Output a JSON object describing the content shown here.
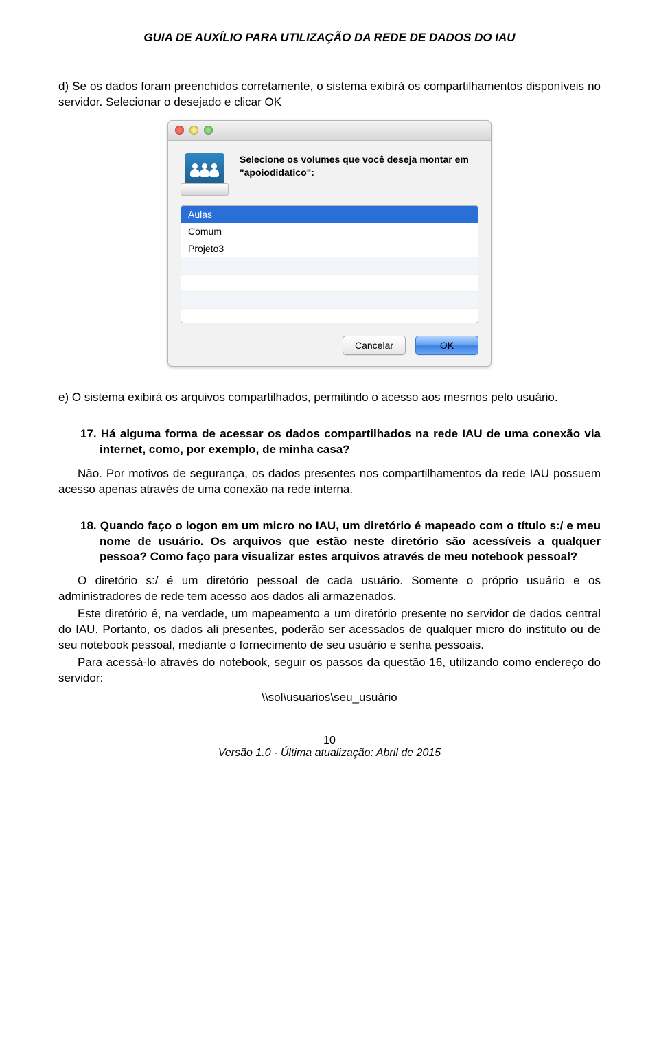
{
  "header": {
    "title": "GUIA DE AUXÍLIO PARA UTILIZAÇÃO DA REDE DE DADOS DO IAU"
  },
  "body": {
    "p_d": "d) Se os dados foram preenchidos corretamente, o sistema exibirá os compartilhamentos disponíveis no servidor. Selecionar o desejado e clicar OK",
    "p_e": "e) O sistema exibirá os arquivos compartilhados, permitindo o acesso aos mesmos pelo usuário."
  },
  "dialog": {
    "message": "Selecione os volumes que você deseja montar em \"apoiodidatico\":",
    "items": [
      "Aulas",
      "Comum",
      "Projeto3"
    ],
    "selected_index": 0,
    "buttons": {
      "cancel": "Cancelar",
      "ok": "OK"
    }
  },
  "q17": {
    "question": "17. Há alguma forma de acessar os dados compartilhados na rede IAU de uma conexão via internet, como, por exemplo, de minha casa?",
    "answer": "Não. Por motivos de segurança, os dados presentes nos compartilhamentos da rede IAU possuem acesso apenas através de uma conexão na rede interna."
  },
  "q18": {
    "question": "18. Quando faço o logon em um micro no IAU, um diretório é mapeado com o título s:/ e meu nome de usuário. Os arquivos que estão neste diretório são acessíveis a qualquer pessoa? Como faço para visualizar estes arquivos através de meu notebook pessoal?",
    "a1": "O diretório s:/ é um diretório pessoal de cada usuário. Somente o próprio usuário e os administradores de rede tem acesso aos dados ali armazenados.",
    "a2": "Este diretório é, na verdade, um mapeamento a um diretório presente no servidor de dados central do IAU.  Portanto, os dados ali presentes, poderão ser acessados de qualquer micro do instituto ou de seu notebook pessoal, mediante o fornecimento de seu usuário e senha pessoais.",
    "a3": "Para acessá-lo através do notebook, seguir os passos da questão 16, utilizando como endereço do servidor:",
    "addr": "\\\\sol\\usuarios\\seu_usuário"
  },
  "footer": {
    "page": "10",
    "version": "Versão 1.0 - Última atualização: Abril de 2015"
  }
}
